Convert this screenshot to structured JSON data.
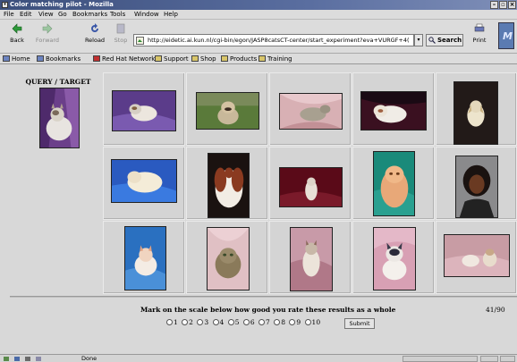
{
  "window": {
    "title": "Color matching pilot - Mozilla",
    "controls": [
      "minimize",
      "maximize",
      "close"
    ]
  },
  "menu": {
    "items": [
      "File",
      "Edit",
      "View",
      "Go",
      "Bookmarks",
      "Tools",
      "Window",
      "Help"
    ]
  },
  "nav": {
    "back": "Back",
    "forward": "Forward",
    "reload": "Reload",
    "stop": "Stop",
    "url": "http://eidetic.ai.kun.nl/cgi-bin/egon/JASP8catsCT-center/start_experiment?eva+VURGF+4(",
    "search": "Search",
    "print": "Print"
  },
  "bookmarks": {
    "items": [
      "Home",
      "Bookmarks",
      "Red Hat Network",
      "Support",
      "Shop",
      "Products",
      "Training"
    ]
  },
  "page": {
    "query_title": "QUERY / TARGET",
    "question": "Mark on the scale below how good you rate these results as a whole",
    "counter": "41/90",
    "scale": [
      "1",
      "2",
      "3",
      "4",
      "5",
      "6",
      "7",
      "8",
      "9",
      "10"
    ],
    "submit": "Submit",
    "query_image": "cat-on-purple-drape",
    "results": [
      "cat-on-purple-cushion",
      "bulldog-on-grass",
      "tabby-cat-on-pink-satin",
      "persian-cat-on-dark-red",
      "white-dog-on-dark",
      "white-persian-on-blue",
      "spaniel-dog-on-dark",
      "kitten-on-dark-red",
      "persian-cat-on-teal",
      "woman-portrait",
      "kitten-on-blue",
      "tabby-cat-on-pink",
      "siamese-cat-on-pink",
      "ragdoll-cat-on-pink",
      "two-cats-on-pink"
    ]
  },
  "status": {
    "text": "Done"
  }
}
